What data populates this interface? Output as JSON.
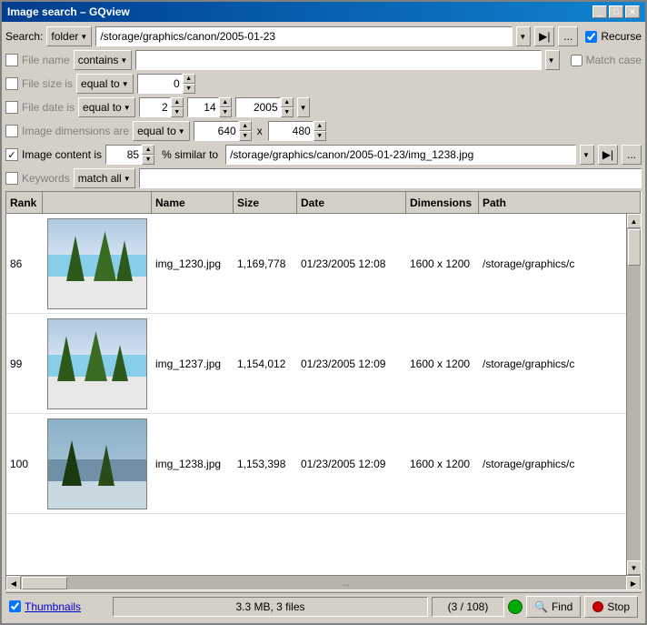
{
  "window": {
    "title": "Image search – GQview",
    "buttons": [
      "_",
      "□",
      "✕"
    ]
  },
  "toolbar": {
    "search_label": "Search:",
    "folder_dropdown": "folder",
    "path_value": "/storage/graphics/canon/2005-01-23",
    "recurse_label": "Recurse"
  },
  "filters": {
    "filename": {
      "enabled": false,
      "label": "File name",
      "mode": "contains",
      "value": "",
      "match_case_label": "Match case",
      "match_case_enabled": false
    },
    "filesize": {
      "enabled": false,
      "label": "File size is",
      "mode": "equal to",
      "value": "0"
    },
    "filedate": {
      "enabled": false,
      "label": "File date is",
      "mode": "equal to",
      "day": "2",
      "month": "14",
      "year": "2005"
    },
    "dimensions": {
      "enabled": false,
      "label": "Image dimensions are",
      "mode": "equal to",
      "width": "640",
      "height": "480"
    },
    "content": {
      "enabled": true,
      "label": "Image content is",
      "similarity": "85",
      "similar_to_label": "% similar to",
      "path": "/storage/graphics/canon/2005-01-23/img_1238.jpg"
    },
    "keywords": {
      "enabled": false,
      "label": "Keywords",
      "mode": "match all",
      "value": ""
    }
  },
  "table": {
    "columns": [
      "Rank",
      "Name",
      "Size",
      "Date",
      "Dimensions",
      "Path"
    ],
    "rows": [
      {
        "rank": "86",
        "name": "img_1230.jpg",
        "size": "1,169,778",
        "date": "01/23/2005 12:08",
        "dimensions": "1600 x 1200",
        "path": "/storage/graphics/c",
        "thumb_style": "winter"
      },
      {
        "rank": "99",
        "name": "img_1237.jpg",
        "size": "1,154,012",
        "date": "01/23/2005 12:09",
        "dimensions": "1600 x 1200",
        "path": "/storage/graphics/c",
        "thumb_style": "winter"
      },
      {
        "rank": "100",
        "name": "img_1238.jpg",
        "size": "1,153,398",
        "date": "01/23/2005 12:09",
        "dimensions": "1600 x 1200",
        "path": "/storage/graphics/c",
        "thumb_style": "winter-blue"
      }
    ]
  },
  "hscroll": {
    "dots": "..."
  },
  "statusbar": {
    "thumbnails_label": "Thumbnails",
    "thumbnails_checked": true,
    "info": "3.3 MB, 3 files",
    "count": "(3 / 108)",
    "find_label": "Find",
    "stop_label": "Stop"
  }
}
